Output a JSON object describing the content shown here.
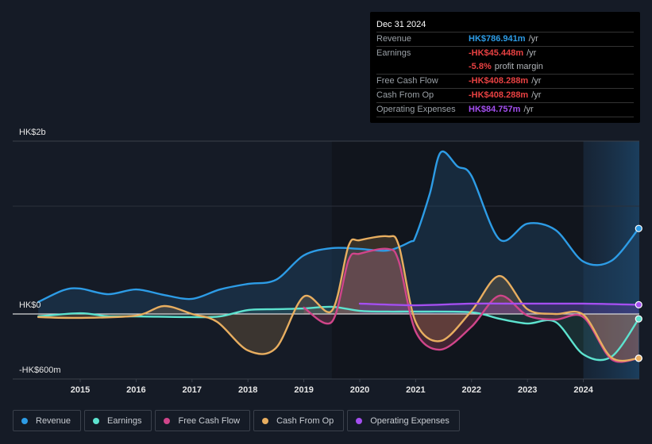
{
  "tooltip": {
    "date": "Dec 31 2024",
    "rows": [
      {
        "label": "Revenue",
        "value": "HK$786.941m",
        "unit": "/yr",
        "color": "#2d9ce6"
      },
      {
        "label": "Earnings",
        "value": "-HK$45.448m",
        "unit": "/yr",
        "color": "#e84142"
      },
      {
        "label": "",
        "value": "-5.8%",
        "unit": "profit margin",
        "color": "#e84142"
      },
      {
        "label": "Free Cash Flow",
        "value": "-HK$408.288m",
        "unit": "/yr",
        "color": "#e84142"
      },
      {
        "label": "Cash From Op",
        "value": "-HK$408.288m",
        "unit": "/yr",
        "color": "#e84142"
      },
      {
        "label": "Operating Expenses",
        "value": "HK$84.757m",
        "unit": "/yr",
        "color": "#a44ff0"
      }
    ]
  },
  "legend": [
    {
      "label": "Revenue",
      "color": "#2d9ce6"
    },
    {
      "label": "Earnings",
      "color": "#5de3cf"
    },
    {
      "label": "Free Cash Flow",
      "color": "#d0458a"
    },
    {
      "label": "Cash From Op",
      "color": "#e8ae60"
    },
    {
      "label": "Operating Expenses",
      "color": "#a44ff0"
    }
  ],
  "chart_data": {
    "type": "line",
    "title": "",
    "xlabel": "",
    "ylabel": "",
    "y_axis_labels": [
      "HK$2b",
      "HK$0",
      "-HK$600m"
    ],
    "x_ticks": [
      "2015",
      "2016",
      "2017",
      "2018",
      "2019",
      "2020",
      "2021",
      "2022",
      "2023",
      "2024"
    ],
    "xlim": [
      2014.25,
      2024.99
    ],
    "ylim_millions": [
      -600,
      1600
    ],
    "highlight_range": [
      2024.0,
      2024.99
    ],
    "grid": true,
    "legend_position": "bottom-left",
    "units": "HK$ millions",
    "series": [
      {
        "name": "Revenue",
        "color": "#2d9ce6",
        "x": [
          2014.25,
          2014.7,
          2015.0,
          2015.5,
          2016.0,
          2016.5,
          2017.0,
          2017.5,
          2018.0,
          2018.5,
          2019.0,
          2019.5,
          2020.0,
          2020.5,
          2020.9,
          2021.0,
          2021.25,
          2021.45,
          2021.75,
          2022.0,
          2022.5,
          2023.0,
          2023.5,
          2024.0,
          2024.5,
          2024.99
        ],
        "values": [
          110,
          219,
          234,
          182,
          226,
          175,
          139,
          226,
          277,
          314,
          540,
          606,
          599,
          584,
          664,
          715,
          1102,
          1489,
          1358,
          1270,
          686,
          832,
          774,
          482,
          489,
          787
        ]
      },
      {
        "name": "Earnings",
        "color": "#5de3cf",
        "x": [
          2014.25,
          2015.0,
          2015.5,
          2016.0,
          2017.0,
          2017.5,
          2018.0,
          2018.5,
          2019.0,
          2019.5,
          2020.0,
          2020.5,
          2021.0,
          2022.0,
          2022.5,
          2023.0,
          2023.5,
          2024.0,
          2024.5,
          2024.99
        ],
        "values": [
          -22,
          7,
          -22,
          -22,
          -29,
          -22,
          36,
          44,
          51,
          66,
          29,
          22,
          22,
          15,
          -44,
          -88,
          -73,
          -372,
          -394,
          -45
        ]
      },
      {
        "name": "Free Cash Flow",
        "color": "#d0458a",
        "x": [
          2019.0,
          2019.5,
          2019.8,
          2020.0,
          2020.5,
          2020.7,
          2021.0,
          2021.45,
          2022.0,
          2022.5,
          2023.0,
          2023.5,
          2024.0,
          2024.5,
          2024.99
        ],
        "values": [
          58,
          -73,
          496,
          555,
          599,
          482,
          -161,
          -328,
          -117,
          168,
          -15,
          -51,
          -29,
          -416,
          -408
        ]
      },
      {
        "name": "Cash From Op",
        "color": "#e8ae60",
        "x": [
          2014.25,
          2015.0,
          2016.0,
          2016.5,
          2017.0,
          2017.45,
          2018.0,
          2018.5,
          2019.0,
          2019.5,
          2019.8,
          2020.0,
          2020.5,
          2020.7,
          2021.0,
          2021.45,
          2022.0,
          2022.5,
          2023.0,
          2023.5,
          2024.0,
          2024.5,
          2024.99
        ],
        "values": [
          -29,
          -36,
          -15,
          73,
          0,
          -73,
          -336,
          -314,
          161,
          29,
          628,
          679,
          715,
          628,
          -73,
          -248,
          29,
          350,
          44,
          0,
          -7,
          -401,
          -408
        ]
      },
      {
        "name": "Operating Expenses",
        "color": "#a44ff0",
        "x": [
          2020.0,
          2021.0,
          2022.0,
          2023.0,
          2024.0,
          2024.99
        ],
        "values": [
          95,
          80,
          95,
          95,
          95,
          85
        ]
      }
    ]
  }
}
